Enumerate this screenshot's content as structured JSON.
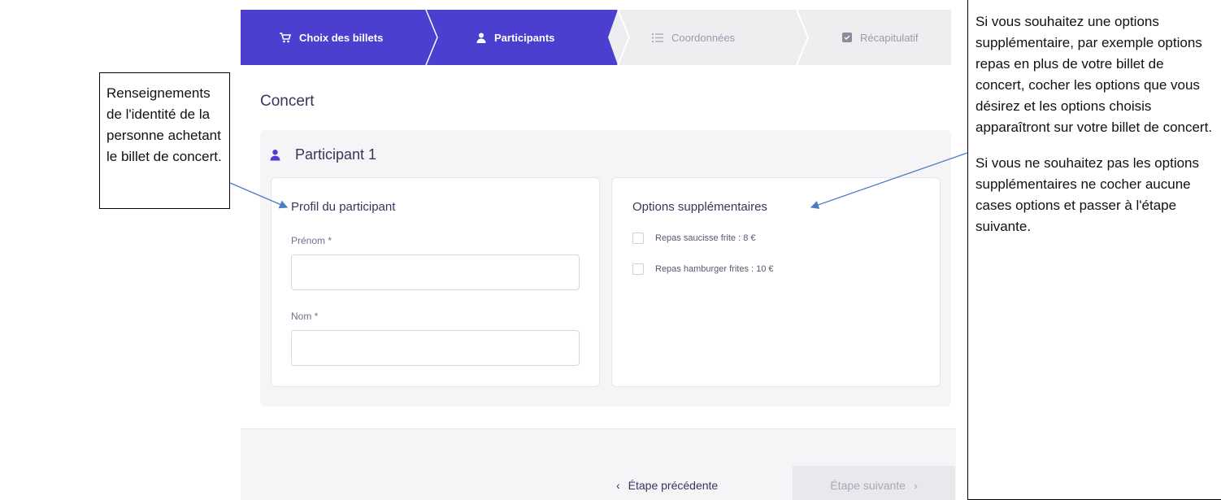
{
  "stepper": {
    "steps": [
      {
        "label": "Choix des billets",
        "icon": "cart-icon",
        "active": true
      },
      {
        "label": "Participants",
        "icon": "user-icon",
        "active": true
      },
      {
        "label": "Coordonnées",
        "icon": "list-icon",
        "active": false
      },
      {
        "label": "Récapitulatif",
        "icon": "checkbox-icon",
        "active": false
      }
    ],
    "active_color": "#4a3fcf",
    "inactive_color": "#eeeef1"
  },
  "page": {
    "title": "Concert"
  },
  "participant": {
    "header": "Participant 1",
    "profile": {
      "title": "Profil du participant",
      "first_name_label": "Prénom *",
      "first_name_value": "",
      "last_name_label": "Nom *",
      "last_name_value": ""
    },
    "options": {
      "title": "Options supplémentaires",
      "items": [
        {
          "label": "Repas saucisse frite : 8 €",
          "checked": false
        },
        {
          "label": "Repas hamburger frites : 10 €",
          "checked": false
        }
      ]
    }
  },
  "footer": {
    "prev_label": "Étape précédente",
    "next_label": "Étape suivante",
    "next_disabled": true
  },
  "callouts": {
    "left": "Renseignements de l'identité de la personne achetant le billet de concert.",
    "right_p1": "Si vous souhaitez une options supplémentaire, par exemple options repas en plus de votre billet de concert, cocher les options que vous désirez et les options choisis apparaîtront sur votre billet de concert.",
    "right_p2": "Si vous ne souhaitez pas les options supplémentaires ne cocher aucune cases options et passer à l'étape suivante."
  }
}
